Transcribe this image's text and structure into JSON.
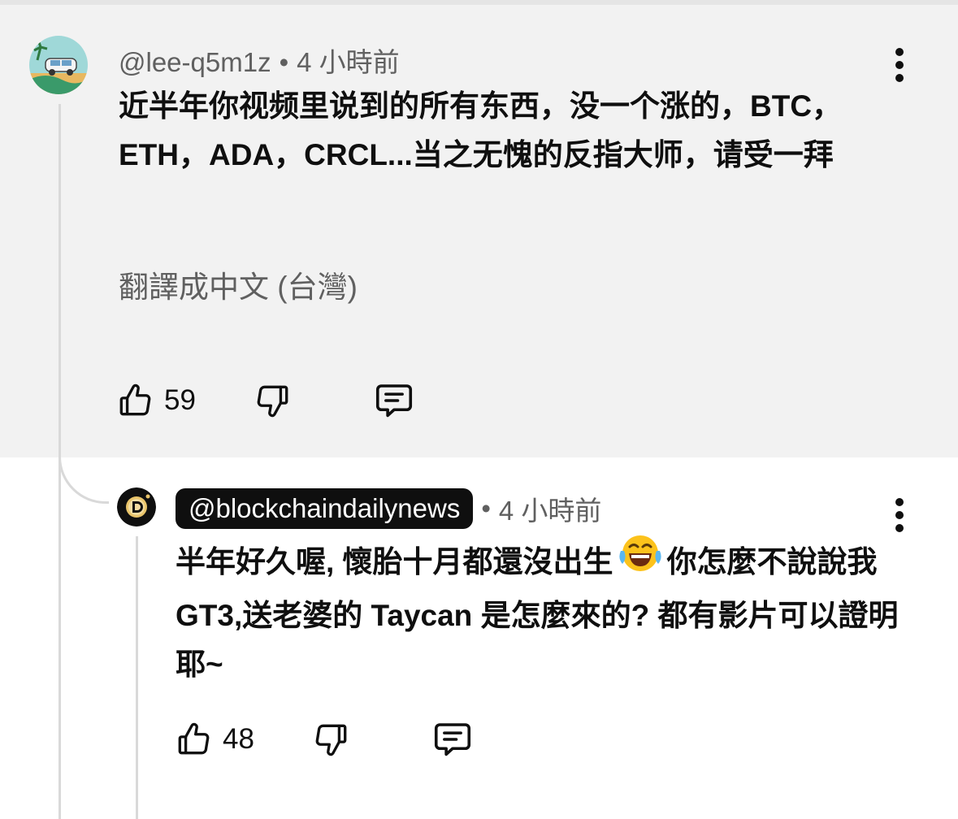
{
  "comment": {
    "handle": "@lee-q5m1z",
    "separator": "•",
    "time": "4 小時前",
    "text": "近半年你视频里说到的所有东西，没一个涨的，BTC，ETH，ADA，CRCL...当之无愧的反指大师，请受一拜",
    "translate_label": "翻譯成中文 (台灣)",
    "likes": "59"
  },
  "reply": {
    "handle": "@blockchaindailynews",
    "separator": "•",
    "time": "4 小時前",
    "text_part1": "半年好久喔, 懷胎十月都還沒出生",
    "emoji": "face-with-tears-of-joy",
    "text_part2": "你怎麼不說說我 GT3,送老婆的 Taycan 是怎麼來的? 都有影片可以證明耶~",
    "likes": "48"
  },
  "colors": {
    "comment_background": "#f2f2f2",
    "secondary_text": "#606060",
    "creator_chip": "#0f0f0f",
    "thread_line": "#d9d9d9"
  },
  "icons": {
    "like": "thumbs-up-icon",
    "dislike": "thumbs-down-icon",
    "reply": "comment-icon",
    "more": "more-vert-icon"
  }
}
